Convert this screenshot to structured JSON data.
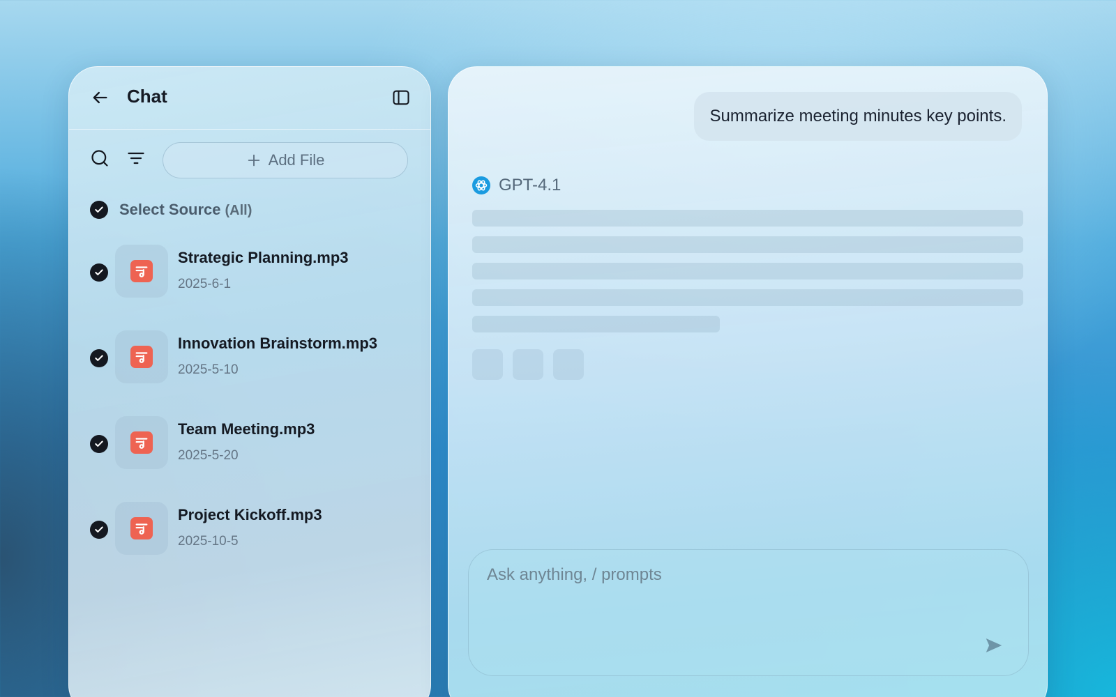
{
  "sidebar": {
    "title": "Chat",
    "add_file_label": "Add File",
    "select_source": {
      "label": "Select Source",
      "sub": "(All)"
    },
    "files": [
      {
        "name": "Strategic Planning.mp3",
        "date": "2025-6-1"
      },
      {
        "name": "Innovation Brainstorm.mp3",
        "date": "2025-5-10"
      },
      {
        "name": "Team Meeting.mp3",
        "date": "2025-5-20"
      },
      {
        "name": "Project Kickoff.mp3",
        "date": "2025-10-5"
      }
    ]
  },
  "chat": {
    "user_message": "Summarize meeting minutes key points.",
    "model_name": "GPT-4.1",
    "input_placeholder": "Ask anything, / prompts"
  },
  "colors": {
    "accent_audio": "#ee6352",
    "check": "#141820"
  },
  "icons": {
    "back": "arrow-left-icon",
    "sidebar_toggle": "sidebar-panel-icon",
    "search": "search-icon",
    "filter": "filter-icon",
    "add": "plus-icon",
    "file": "audio-file-icon",
    "model": "openai-logo-icon",
    "send": "send-icon"
  }
}
